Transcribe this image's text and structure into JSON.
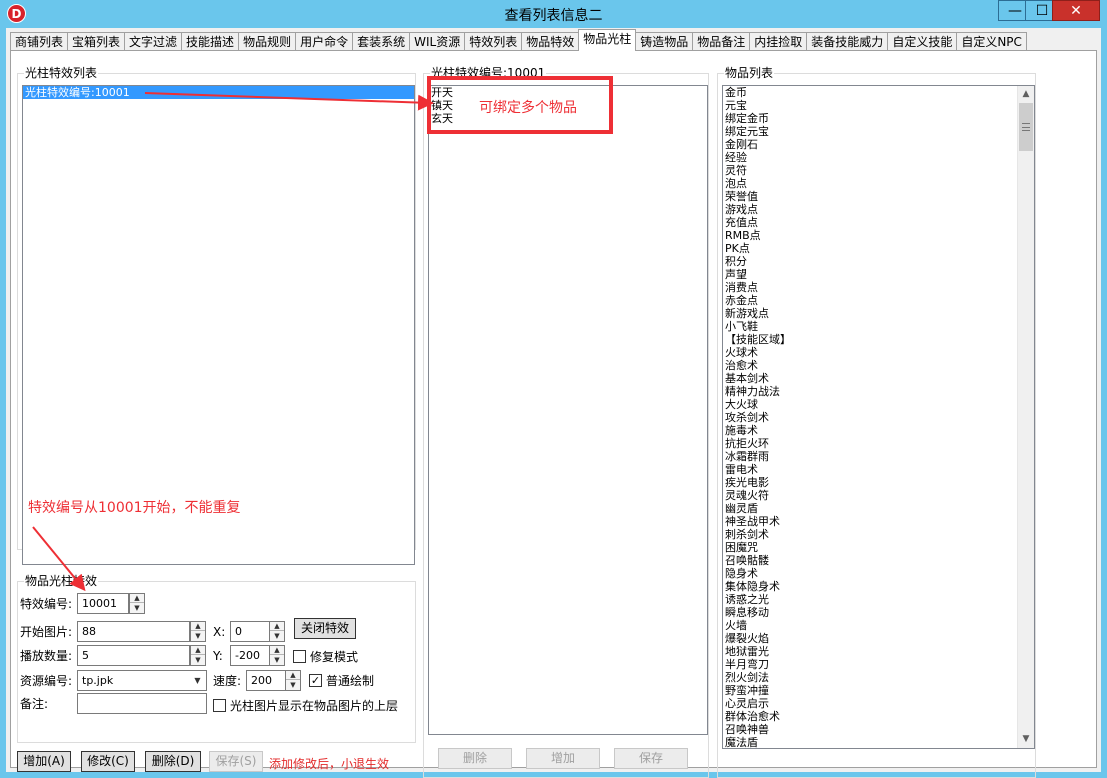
{
  "window": {
    "title": "查看列表信息二",
    "icon_letter": "D",
    "min_symbol": "—",
    "max_symbol": "☐",
    "close_symbol": "✕"
  },
  "tabs": [
    {
      "label": "商铺列表",
      "active": false
    },
    {
      "label": "宝箱列表",
      "active": false
    },
    {
      "label": "文字过滤",
      "active": false
    },
    {
      "label": "技能描述",
      "active": false
    },
    {
      "label": "物品规则",
      "active": false
    },
    {
      "label": "用户命令",
      "active": false
    },
    {
      "label": "套装系统",
      "active": false
    },
    {
      "label": "WIL资源",
      "active": false
    },
    {
      "label": "特效列表",
      "active": false
    },
    {
      "label": "物品特效",
      "active": false
    },
    {
      "label": "物品光柱",
      "active": true
    },
    {
      "label": "铸造物品",
      "active": false
    },
    {
      "label": "物品备注",
      "active": false
    },
    {
      "label": "内挂捡取",
      "active": false
    },
    {
      "label": "装备技能威力",
      "active": false
    },
    {
      "label": "自定义技能",
      "active": false
    },
    {
      "label": "自定义NPC",
      "active": false
    }
  ],
  "effect_list": {
    "label": "光柱特效列表",
    "items": [
      "光柱特效编号:10001"
    ]
  },
  "effect_items": {
    "label": "光柱特效编号:10001",
    "items": [
      "开天",
      "镇天",
      "玄天"
    ],
    "buttons": {
      "delete": "删除",
      "add": "增加",
      "save": "保存"
    }
  },
  "item_list": {
    "label": "物品列表",
    "items": [
      "金币",
      "元宝",
      "绑定金币",
      "绑定元宝",
      "金刚石",
      "经验",
      "灵符",
      "泡点",
      "荣誉值",
      "游戏点",
      "充值点",
      "RMB点",
      "PK点",
      "积分",
      "声望",
      "消费点",
      "赤金点",
      "新游戏点",
      "小飞鞋",
      "【技能区域】",
      "火球术",
      "治愈术",
      "基本剑术",
      "精神力战法",
      "大火球",
      "攻杀剑术",
      "施毒术",
      "抗拒火环",
      "冰霜群雨",
      "雷电术",
      "疾光电影",
      "灵魂火符",
      "幽灵盾",
      "神圣战甲术",
      "刺杀剑术",
      "困魔咒",
      "召唤骷髅",
      "隐身术",
      "集体隐身术",
      "诱惑之光",
      "瞬息移动",
      "火墙",
      "爆裂火焰",
      "地狱雷光",
      "半月弯刀",
      "烈火剑法",
      "野蛮冲撞",
      "心灵启示",
      "群体治愈术",
      "召唤神兽",
      "魔法盾"
    ],
    "scroll_up": "▲",
    "scroll_down": "▼"
  },
  "form": {
    "group_label": "物品光柱特效",
    "effect_id_label": "特效编号:",
    "effect_id_value": "10001",
    "start_image_label": "开始图片:",
    "start_image_value": "88",
    "play_count_label": "播放数量:",
    "play_count_value": "5",
    "resource_label": "资源编号:",
    "resource_value": "tp.jpk",
    "remark_label": "备注:",
    "remark_value": "",
    "x_label": "X:",
    "x_value": "0",
    "y_label": "Y:",
    "y_value": "-200",
    "speed_label": "速度:",
    "speed_value": "200",
    "close_effect_button": "关闭特效",
    "repair_mode_label": "修复模式",
    "repair_mode_checked": false,
    "normal_draw_label": "普通绘制",
    "normal_draw_checked": true,
    "top_layer_label": "光柱图片显示在物品图片的上层",
    "top_layer_checked": false,
    "spin_up": "▲",
    "spin_down": "▼",
    "combo_arrow": "▼",
    "check_mark": "✓"
  },
  "bottom_buttons": {
    "add": "增加(A)",
    "modify": "修改(C)",
    "delete": "删除(D)",
    "save": "保存(S)",
    "hint": "添加修改后，小退生效"
  },
  "annotations": {
    "multi_bind": "可绑定多个物品",
    "id_rule": "特效编号从10001开始，不能重复",
    "color": "#ee2f35"
  }
}
